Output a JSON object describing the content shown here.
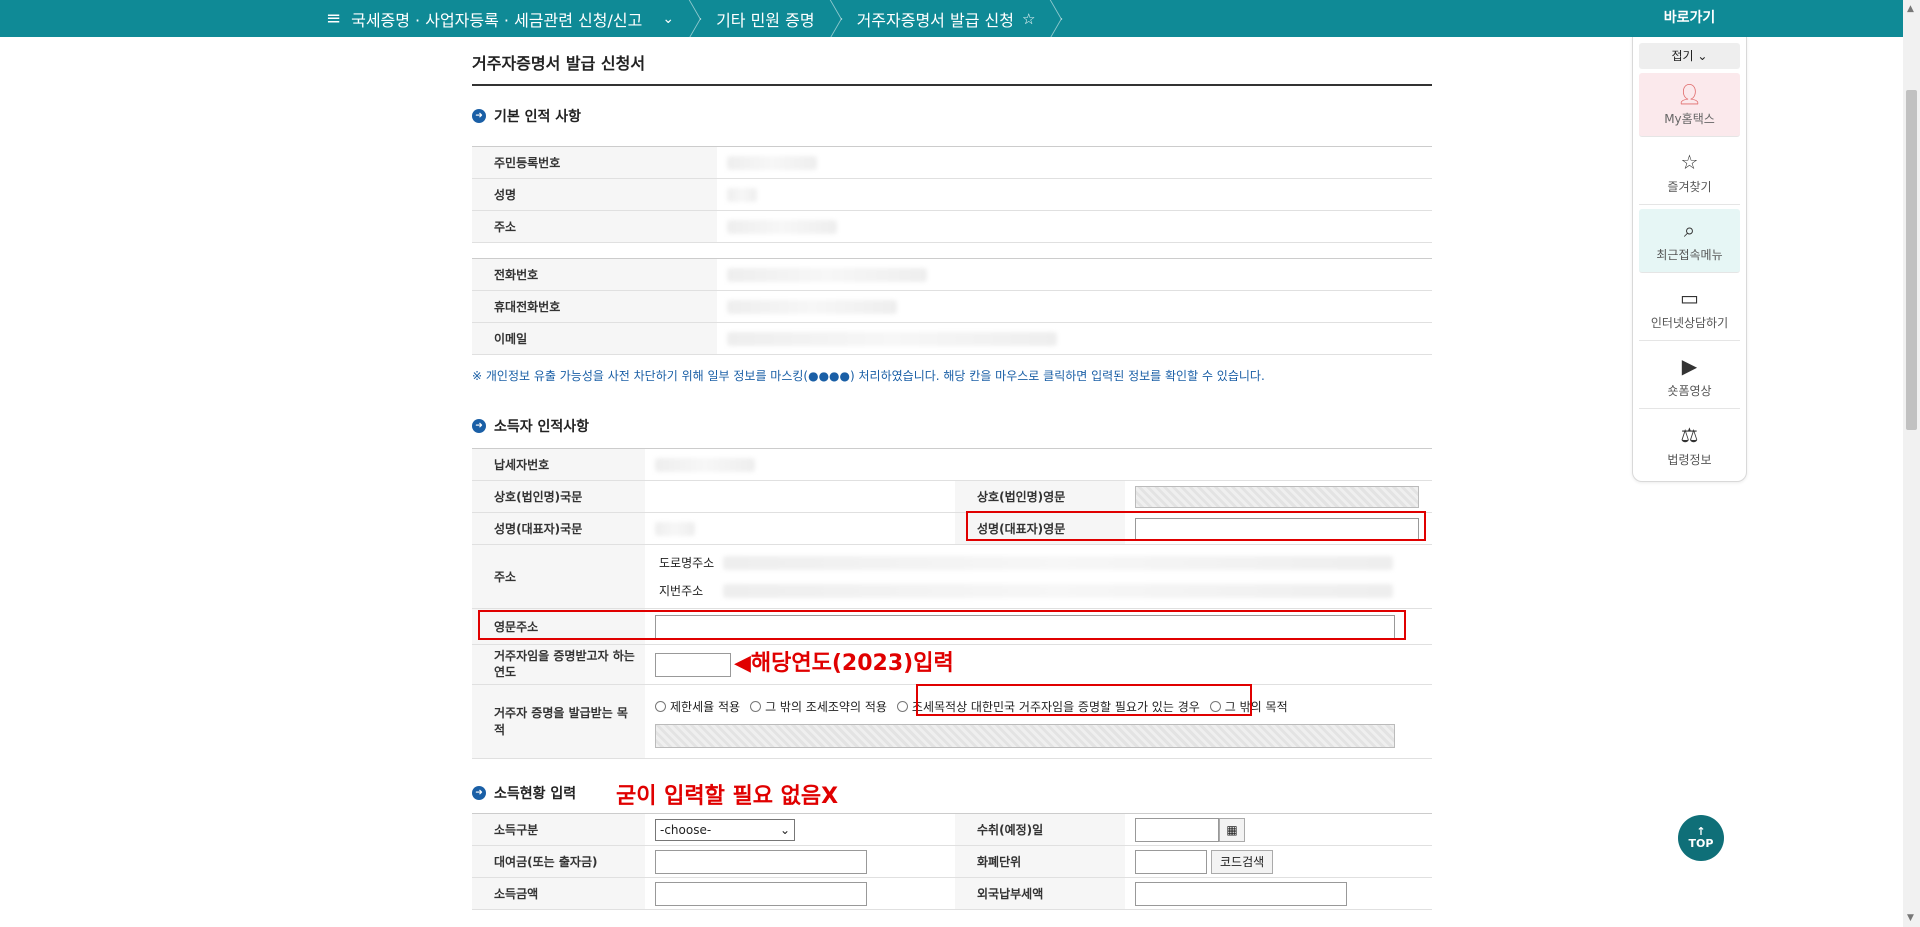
{
  "nav": {
    "menu_label": "국세증명 · 사업자등록 · 세금관련 신청/신고",
    "crumb2": "기타 민원 증명",
    "crumb3": "거주자증명서 발급 신청"
  },
  "page_title": "거주자증명서 발급 신청서",
  "section1": {
    "title": "기본 인적 사항",
    "rows": [
      "주민등록번호",
      "성명",
      "주소",
      "전화번호",
      "휴대전화번호",
      "이메일"
    ]
  },
  "privacy_note": "※ 개인정보 유출 가능성을 사전 차단하기 위해 일부 정보를 마스킹(●●●●) 처리하였습니다. 해당 칸을 마우스로 클릭하면 입력된 정보를 확인할 수 있습니다.",
  "section2": {
    "title": "소득자 인적사항",
    "taxpayer_no": "납세자번호",
    "company_kr": "상호(법인명)국문",
    "company_en": "상호(법인명)영문",
    "name_kr": "성명(대표자)국문",
    "name_en": "성명(대표자)영문",
    "address": "주소",
    "road_address": "도로명주소",
    "lot_address": "지번주소",
    "english_address": "영문주소",
    "year_label": "거주자임을 증명받고자 하는 연도",
    "purpose_label": "거주자 증명을 발급받는 목적",
    "purpose_options": [
      "제한세율 적용",
      "그 밖의 조세조약의 적용",
      "조세목적상 대한민국 거주자임을 증명할 필요가 있는 경우",
      "그 밖의 목적"
    ]
  },
  "annotations": {
    "year_hint": "◀해당연도(2023)입력",
    "no_need": "굳이 입력할 필요 없음X"
  },
  "section3": {
    "title": "소득현황 입력",
    "income_type": "소득구분",
    "income_select": "-choose-",
    "receipt_date": "수취(예정)일",
    "loan": "대여금(또는 출자금)",
    "currency": "화폐단위",
    "code_search": "코드검색",
    "income_amount": "소득금액",
    "foreign_tax": "외국납부세액"
  },
  "quick_menu": {
    "title": "바로가기",
    "fold": "접기",
    "items": [
      "My홈택스",
      "즐겨찾기",
      "최근접속메뉴",
      "인터넷상담하기",
      "숏폼영상",
      "법령정보"
    ]
  },
  "top_button": {
    "arrow": "↑",
    "label": "TOP"
  }
}
